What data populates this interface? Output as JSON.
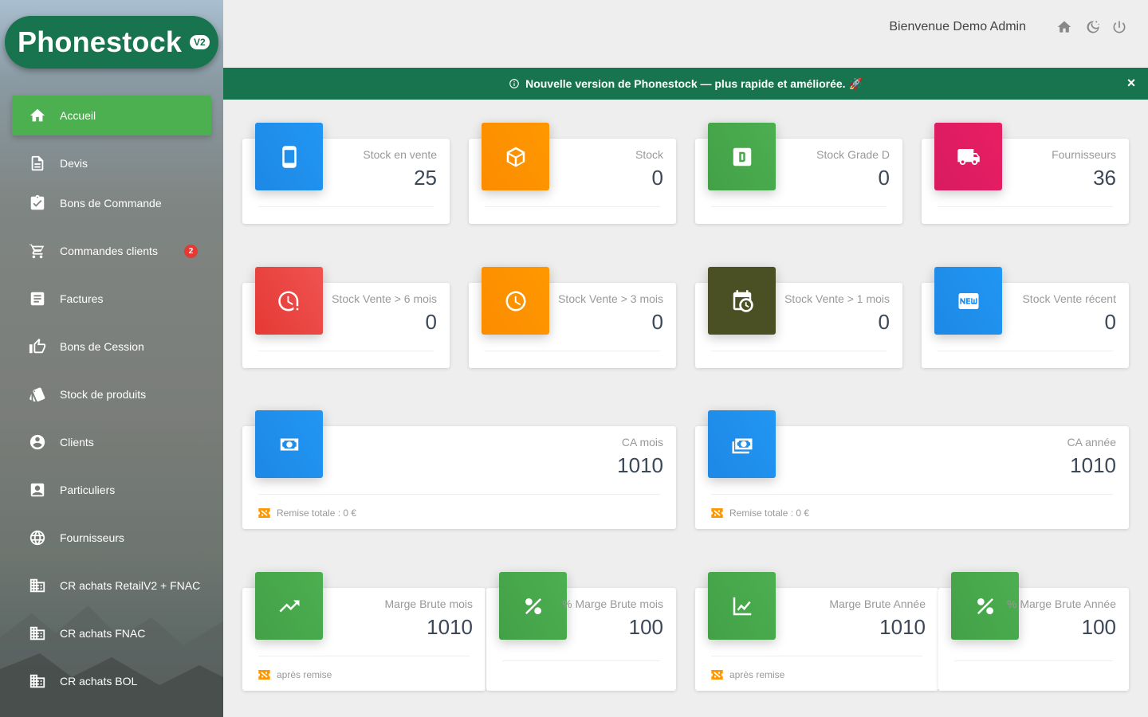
{
  "app": {
    "name": "Phonestock",
    "version": "V2"
  },
  "header": {
    "welcome": "Bienvenue Demo Admin",
    "icons": [
      "home-icon",
      "night-mode-icon",
      "power-icon"
    ]
  },
  "banner": {
    "text": "Nouvelle version de Phonestock — plus rapide et améliorée. 🚀",
    "close": "×"
  },
  "sidebar": {
    "items": [
      {
        "label": "Accueil",
        "icon": "home-icon",
        "active": true
      },
      {
        "label": "Devis",
        "icon": "document-icon"
      },
      {
        "label": "Bons de Commande",
        "icon": "clipboard-check-icon"
      },
      {
        "label": "Commandes clients",
        "icon": "cart-icon",
        "badge": "2"
      },
      {
        "label": "Factures",
        "icon": "invoice-icon"
      },
      {
        "label": "Bons de Cession",
        "icon": "thumbs-up-icon"
      },
      {
        "label": "Stock de produits",
        "icon": "cards-icon"
      },
      {
        "label": "Clients",
        "icon": "account-circle-icon"
      },
      {
        "label": "Particuliers",
        "icon": "contact-card-icon"
      },
      {
        "label": "Fournisseurs",
        "icon": "globe-icon"
      },
      {
        "label": "CR achats RetailV2 + FNAC",
        "icon": "building-icon"
      },
      {
        "label": "CR achats FNAC",
        "icon": "building-icon"
      },
      {
        "label": "CR achats BOL",
        "icon": "building-icon"
      }
    ]
  },
  "cards": {
    "stock_en_vente": {
      "label": "Stock en vente",
      "value": "25",
      "color": "#2196f3",
      "icon": "phone-icon"
    },
    "stock": {
      "label": "Stock",
      "value": "0",
      "color": "#ff9800",
      "icon": "box-icon"
    },
    "stock_grade_d": {
      "label": "Stock Grade D",
      "value": "0",
      "color": "#4caf50",
      "icon": "grade-d-icon"
    },
    "fournisseurs": {
      "label": "Fournisseurs",
      "value": "36",
      "color": "#e91e63",
      "icon": "truck-icon"
    },
    "stock_vente_6": {
      "label": "Stock Vente > 6 mois",
      "value": "0",
      "color": "#ef5350",
      "icon": "clock-alert-icon"
    },
    "stock_vente_3": {
      "label": "Stock Vente > 3 mois",
      "value": "0",
      "color": "#ff9800",
      "icon": "clock-icon"
    },
    "stock_vente_1": {
      "label": "Stock Vente > 1 mois",
      "value": "0",
      "color": "#4a5023",
      "icon": "calendar-clock-icon"
    },
    "stock_vente_recent": {
      "label": "Stock Vente récent",
      "value": "0",
      "color": "#2196f3",
      "icon": "new-icon"
    },
    "ca_mois": {
      "label": "CA mois",
      "value": "1010",
      "footer": "Remise totale : 0 €",
      "color": "#2196f3",
      "icon": "cash-icon"
    },
    "ca_annee": {
      "label": "CA année",
      "value": "1010",
      "footer": "Remise totale : 0 €",
      "color": "#2196f3",
      "icon": "cash-multiple-icon"
    },
    "marge_mois": {
      "label": "Marge Brute mois",
      "value": "1010",
      "footer": "après remise",
      "color": "#4caf50",
      "icon": "trending-up-icon"
    },
    "pct_marge_mois": {
      "label": "% Marge Brute mois",
      "value": "100",
      "color": "#4caf50",
      "icon": "percent-icon"
    },
    "marge_annee": {
      "label": "Marge Brute Année",
      "value": "1010",
      "footer": "après remise",
      "color": "#4caf50",
      "icon": "chart-line-icon"
    },
    "pct_marge_annee": {
      "label": "% Marge Brute Année",
      "value": "100",
      "color": "#4caf50",
      "icon": "percent-icon"
    }
  }
}
